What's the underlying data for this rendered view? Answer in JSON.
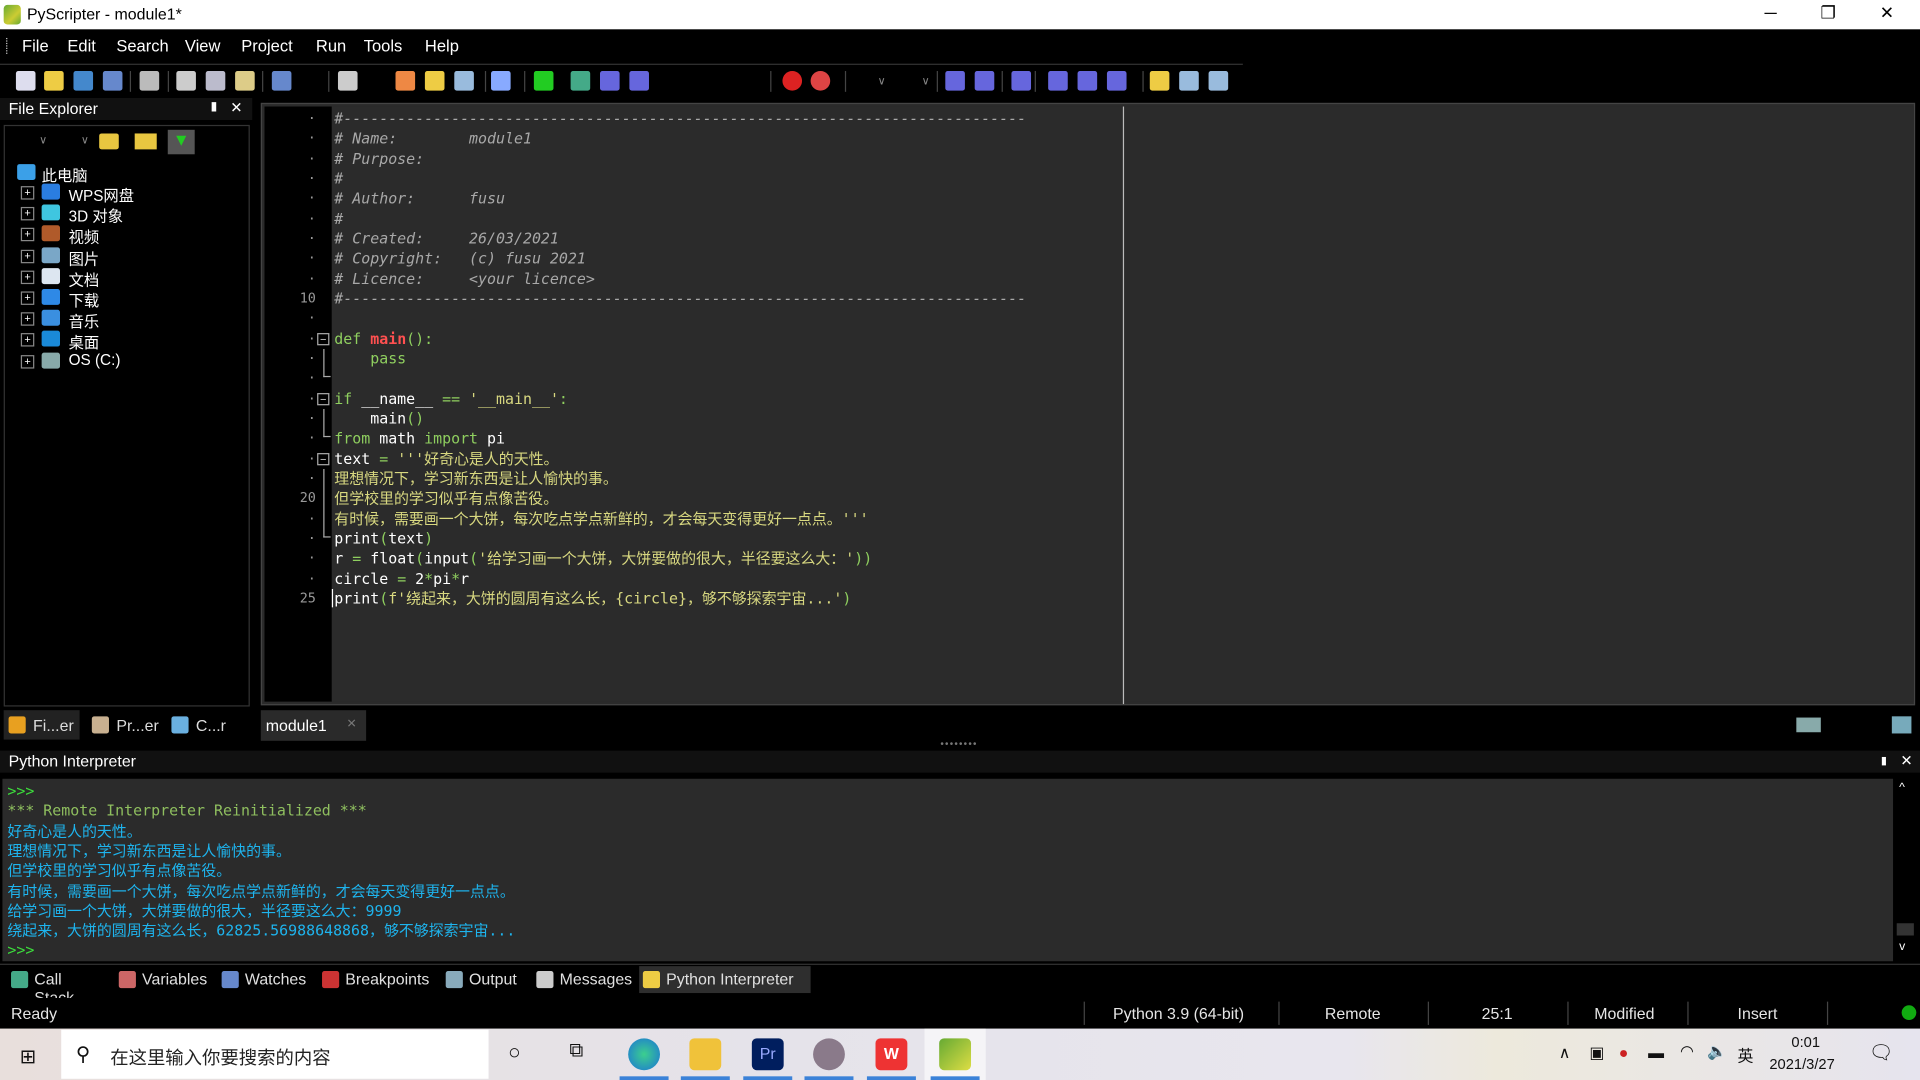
{
  "window": {
    "title": "PyScripter - module1*",
    "min": "─",
    "max": "❐",
    "close": "✕"
  },
  "menu": [
    "File",
    "Edit",
    "Search",
    "View",
    "Project",
    "Run",
    "Tools",
    "Help"
  ],
  "toolbar": {
    "icons": [
      "new-file",
      "open-file",
      "save",
      "save-all",
      "print",
      "cut",
      "copy",
      "paste",
      "undo",
      "find",
      "replace",
      "find-in-files",
      "find-next",
      "info",
      "run",
      "debug",
      "step-into",
      "step-over",
      "breakpoint",
      "clear-breakpoints",
      "dropdown-a",
      "dropdown-b",
      "indent",
      "dedent",
      "comment",
      "line-numbers",
      "word-wrap",
      "special-chars",
      "python",
      "layout",
      "view-menu"
    ]
  },
  "file_explorer": {
    "title": "File Explorer",
    "pin": "📌",
    "close": "✕",
    "items": [
      {
        "label": "此电脑",
        "icon": "computer-icon",
        "color": "#3ba0e8",
        "root": true
      },
      {
        "label": "WPS网盘",
        "icon": "cloud-icon",
        "color": "#2a7de1"
      },
      {
        "label": "3D 对象",
        "icon": "cube-icon",
        "color": "#3fc6e0"
      },
      {
        "label": "视频",
        "icon": "video-icon",
        "color": "#b05a2a"
      },
      {
        "label": "图片",
        "icon": "picture-icon",
        "color": "#7aa7c7"
      },
      {
        "label": "文档",
        "icon": "document-icon",
        "color": "#dde6f0"
      },
      {
        "label": "下载",
        "icon": "download-icon",
        "color": "#2e89e6"
      },
      {
        "label": "音乐",
        "icon": "music-icon",
        "color": "#3a8fe0"
      },
      {
        "label": "桌面",
        "icon": "desktop-icon",
        "color": "#1a8ad8"
      },
      {
        "label": "OS (C:)",
        "icon": "drive-icon",
        "color": "#8aa"
      }
    ],
    "tabs": [
      "Fi...er",
      "Pr...er",
      "C...r"
    ]
  },
  "editor": {
    "tab": "module1",
    "tab_close": "✕",
    "lines": [
      [
        [
          "#----------------------------------------------------------------------------",
          "comment"
        ]
      ],
      [
        [
          "# Name:        module1",
          "comment"
        ]
      ],
      [
        [
          "# Purpose:",
          "comment"
        ]
      ],
      [
        [
          "#",
          "comment"
        ]
      ],
      [
        [
          "# Author:      fusu",
          "comment"
        ]
      ],
      [
        [
          "#",
          "comment"
        ]
      ],
      [
        [
          "# Created:     26/03/2021",
          "comment"
        ]
      ],
      [
        [
          "# Copyright:   (c) fusu 2021",
          "comment"
        ]
      ],
      [
        [
          "# Licence:     <your licence>",
          "comment"
        ]
      ],
      [
        [
          "#----------------------------------------------------------------------------",
          "comment"
        ]
      ],
      [],
      [
        [
          "def ",
          "kw"
        ],
        [
          "main",
          "fn"
        ],
        [
          "():",
          "op"
        ]
      ],
      [
        [
          "    pass",
          "kw"
        ]
      ],
      [],
      [
        [
          "if ",
          "kw"
        ],
        [
          "__name__",
          "txt"
        ],
        [
          " == ",
          "op"
        ],
        [
          "'__main__'",
          "str"
        ],
        [
          ":",
          "op"
        ]
      ],
      [
        [
          "    main",
          "txt"
        ],
        [
          "()",
          "op"
        ]
      ],
      [
        [
          "from ",
          "kw"
        ],
        [
          "math ",
          "txt"
        ],
        [
          "import ",
          "kw"
        ],
        [
          "pi",
          "txt"
        ]
      ],
      [
        [
          "text ",
          "txt"
        ],
        [
          "= ",
          "op"
        ],
        [
          "'''好奇心是人的天性。",
          "str"
        ]
      ],
      [
        [
          "理想情况下，学习新东西是让人愉快的事。",
          "str"
        ]
      ],
      [
        [
          "但学校里的学习似乎有点像苦役。",
          "str"
        ]
      ],
      [
        [
          "有时候，需要画一个大饼，每次吃点学点新鲜的，才会每天变得更好一点点。'''",
          "str"
        ]
      ],
      [
        [
          "print",
          "txt"
        ],
        [
          "(",
          "op"
        ],
        [
          "text",
          "txt"
        ],
        [
          ")",
          "op"
        ]
      ],
      [
        [
          "r ",
          "txt"
        ],
        [
          "= ",
          "op"
        ],
        [
          "float",
          "txt"
        ],
        [
          "(",
          "op"
        ],
        [
          "input",
          "txt"
        ],
        [
          "(",
          "op"
        ],
        [
          "'给学习画一个大饼，大饼要做的很大，半径要这么大：'",
          "str"
        ],
        [
          "))",
          "op"
        ]
      ],
      [
        [
          "circle ",
          "txt"
        ],
        [
          "= ",
          "op"
        ],
        [
          "2",
          "txt"
        ],
        [
          "*",
          "op"
        ],
        [
          "pi",
          "txt"
        ],
        [
          "*",
          "op"
        ],
        [
          "r",
          "txt"
        ]
      ],
      [
        [
          "print",
          "txt"
        ],
        [
          "(",
          "op"
        ],
        [
          "f'绕起来，大饼的圆周有这么长，{circle}，够不够探索宇宙...'",
          "str"
        ],
        [
          ")",
          "op"
        ]
      ]
    ]
  },
  "interpreter": {
    "title": "Python Interpreter",
    "lines": [
      [
        ">>>",
        "#3cdc3c"
      ],
      [
        "*** Remote Interpreter Reinitialized ***",
        "#8fbf5f"
      ],
      [
        "好奇心是人的天性。",
        "#1eb4ee"
      ],
      [
        "理想情况下，学习新东西是让人愉快的事。",
        "#1eb4ee"
      ],
      [
        "但学校里的学习似乎有点像苦役。",
        "#1eb4ee"
      ],
      [
        "有时候，需要画一个大饼，每次吃点学点新鲜的，才会每天变得更好一点点。",
        "#1eb4ee"
      ],
      [
        "给学习画一个大饼，大饼要做的很大，半径要这么大：9999",
        "#1eb4ee"
      ],
      [
        "绕起来，大饼的圆周有这么长，62825.56988648868，够不够探索宇宙...",
        "#1eb4ee"
      ],
      [
        ">>>",
        "#3cdc3c"
      ]
    ]
  },
  "bottom_tabs": [
    "Call Stack",
    "Variables",
    "Watches",
    "Breakpoints",
    "Output",
    "Messages",
    "Python Interpreter"
  ],
  "status": {
    "left": "Ready",
    "python": "Python 3.9 (64-bit)",
    "engine": "Remote",
    "position": "25:1",
    "modified": "Modified",
    "mode": "Insert"
  },
  "taskbar": {
    "search": "在这里输入你要搜索的内容",
    "time": "0:01",
    "date": "2021/3/27",
    "ime": "英"
  }
}
